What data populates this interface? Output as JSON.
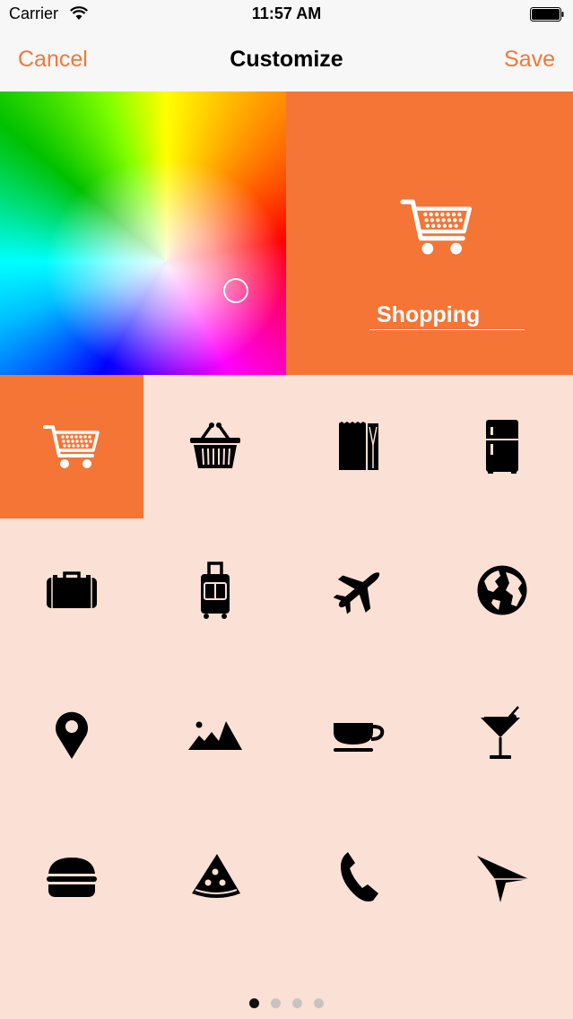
{
  "status_bar": {
    "carrier": "Carrier",
    "time": "11:57 AM",
    "wifi_icon": "wifi-icon",
    "battery_icon": "battery-icon"
  },
  "nav": {
    "cancel_label": "Cancel",
    "title": "Customize",
    "save_label": "Save"
  },
  "colors": {
    "accent": "#f47535",
    "nav_text": "#f07838",
    "background": "#fbe0d6"
  },
  "preview": {
    "icon": "shopping-cart-icon",
    "name": "Shopping"
  },
  "icons": [
    "shopping-cart-icon",
    "shopping-basket-icon",
    "paper-bag-icon",
    "refrigerator-icon",
    "briefcase-icon",
    "suitcase-icon",
    "airplane-icon",
    "globe-icon",
    "map-pin-icon",
    "mountains-icon",
    "coffee-cup-icon",
    "cocktail-icon",
    "hamburger-icon",
    "pizza-slice-icon",
    "phone-icon",
    "paper-plane-icon"
  ],
  "selected_icon_index": 0,
  "pagination": {
    "pages": 4,
    "current": 0
  }
}
